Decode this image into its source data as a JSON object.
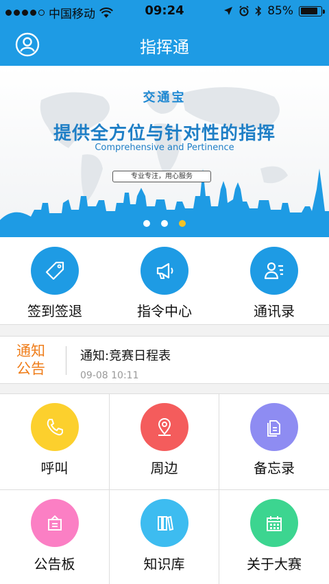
{
  "status_bar": {
    "carrier": "中国移动",
    "time": "09:24",
    "battery": "85%",
    "battery_level": 0.85
  },
  "nav": {
    "title": "指挥通"
  },
  "banner": {
    "brand": "交通宝",
    "headline": "提供全方位与针对性的指挥",
    "subtitle": "Comprehensive and Pertinence",
    "pill": "专业专注，用心服务",
    "page_count": 3,
    "active_page": 3
  },
  "quick_actions": [
    {
      "label": "签到签退",
      "icon": "tag-icon"
    },
    {
      "label": "指令中心",
      "icon": "megaphone-icon"
    },
    {
      "label": "通讯录",
      "icon": "contacts-icon"
    }
  ],
  "notice": {
    "tag": "通知公告",
    "title": "通知:竞赛日程表",
    "time": "09-08 10:11",
    "accent": "#ef7d1a"
  },
  "grid": [
    {
      "label": "呼叫",
      "icon": "phone-icon",
      "color": "#fcd02d"
    },
    {
      "label": "周边",
      "icon": "location-pin-icon",
      "color": "#f45c5c"
    },
    {
      "label": "备忘录",
      "icon": "documents-icon",
      "color": "#8e8cf2"
    },
    {
      "label": "公告板",
      "icon": "board-icon",
      "color": "#fb7fc4"
    },
    {
      "label": "知识库",
      "icon": "books-icon",
      "color": "#3dbcf0"
    },
    {
      "label": "关于大赛",
      "icon": "calendar-icon",
      "color": "#3cd590"
    }
  ],
  "colors": {
    "primary": "#1e9be4",
    "pager_active": "#f4c225"
  }
}
